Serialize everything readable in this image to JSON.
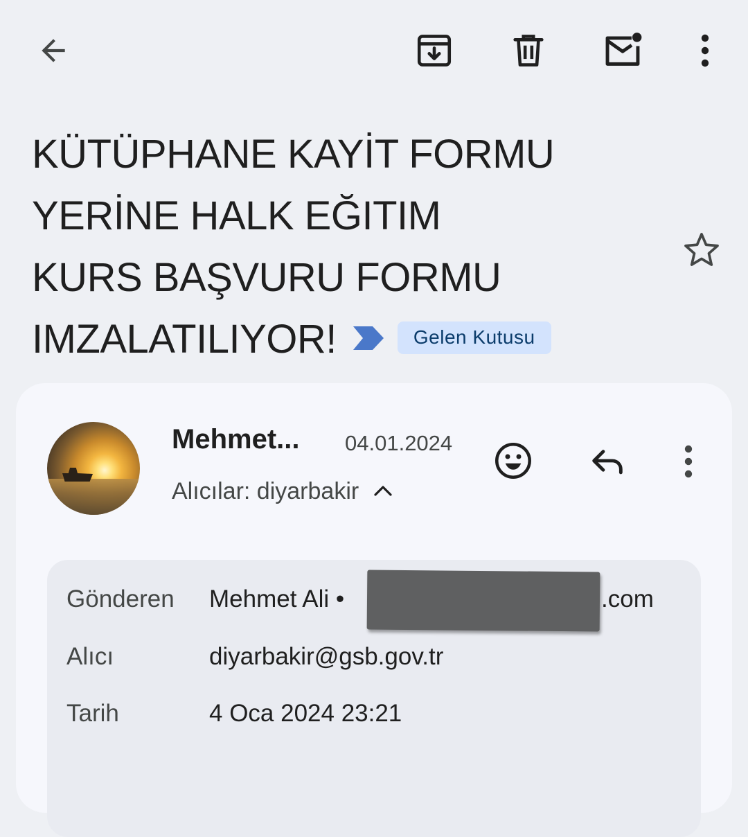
{
  "toolbar": {
    "back_icon": "arrow-back-icon",
    "archive_icon": "archive-icon",
    "delete_icon": "trash-icon",
    "mark_unread_icon": "mark-unread-icon",
    "more_icon": "more-vert-icon"
  },
  "subject": {
    "lines": [
      "KÜTÜPHANE KAYİT FORMU",
      "YERİNE HALK EĞITIM",
      "KURS BAŞVURU FORMU",
      "IMZALATILIYOR!"
    ],
    "label": "Gelen Kutusu",
    "importance_color": "#4a78c9",
    "star_icon": "star-outline-icon"
  },
  "message": {
    "sender_name": "Mehmet...",
    "date": "04.01.2024",
    "recipients": "Alıcılar: diyarbakir",
    "emoji_icon": "add-reaction-icon",
    "reply_icon": "reply-icon",
    "more_icon": "more-vert-icon"
  },
  "details": {
    "from_label": "Gönderen",
    "from_value": "Mehmet Ali •",
    "from_suffix": ".com",
    "to_label": "Alıcı",
    "to_value": "diyarbakir@gsb.gov.tr",
    "date_label": "Tarih",
    "date_value": "4 Oca 2024 23:21"
  },
  "colors": {
    "background": "#eef0f4",
    "card": "#f6f7fc",
    "label_chip": "#d3e3fd",
    "link": "#0b57d0"
  }
}
